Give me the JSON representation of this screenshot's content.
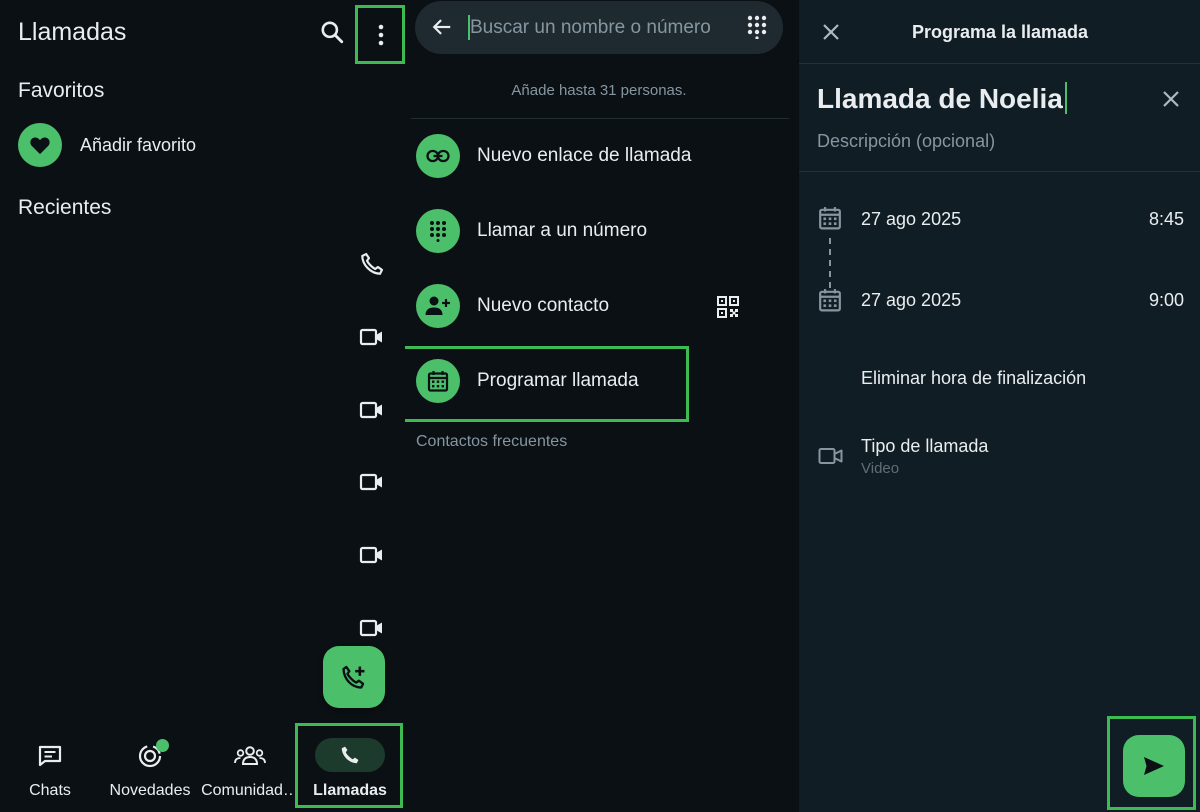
{
  "colors": {
    "accent": "#4cbf6b",
    "highlight": "#3dbb52",
    "background": "#0b1014",
    "panel3_background": "#101d25"
  },
  "calls_screen": {
    "title": "Llamadas",
    "search_icon": "search-icon",
    "menu_icon": "more-vert-icon",
    "favorites_heading": "Favoritos",
    "add_favorite_label": "Añadir favorito",
    "recents_heading": "Recientes",
    "recent_call_icons": [
      "phone-icon",
      "video-icon",
      "video-icon",
      "video-icon",
      "video-icon",
      "video-icon"
    ],
    "fab_icon": "add-call-icon",
    "bottom_nav": [
      {
        "label": "Chats",
        "icon": "chats-icon"
      },
      {
        "label": "Novedades",
        "icon": "updates-icon",
        "badge": true
      },
      {
        "label": "Comunidad…",
        "icon": "communities-icon"
      },
      {
        "label": "Llamadas",
        "icon": "phone-icon",
        "active": true
      }
    ]
  },
  "new_call_screen": {
    "search": {
      "placeholder": "Buscar un nombre o número"
    },
    "note": "Añade hasta 31 personas.",
    "actions": [
      {
        "label": "Nuevo enlace de llamada",
        "icon": "link-icon"
      },
      {
        "label": "Llamar a un número",
        "icon": "dialpad-icon"
      },
      {
        "label": "Nuevo contacto",
        "icon": "add-person-icon"
      },
      {
        "label": "Programar llamada",
        "icon": "calendar-icon"
      }
    ],
    "frequent_contacts_heading": "Contactos frecuentes"
  },
  "schedule_screen": {
    "title": "Programa la llamada",
    "call_name": "Llamada de Noelia",
    "description_placeholder": "Descripción (opcional)",
    "start": {
      "date": "27 ago 2025",
      "time": "8:45"
    },
    "end": {
      "date": "27 ago 2025",
      "time": "9:00"
    },
    "remove_end_time_label": "Eliminar hora de finalización",
    "call_type_label": "Tipo de llamada",
    "call_type_value": "Video"
  }
}
